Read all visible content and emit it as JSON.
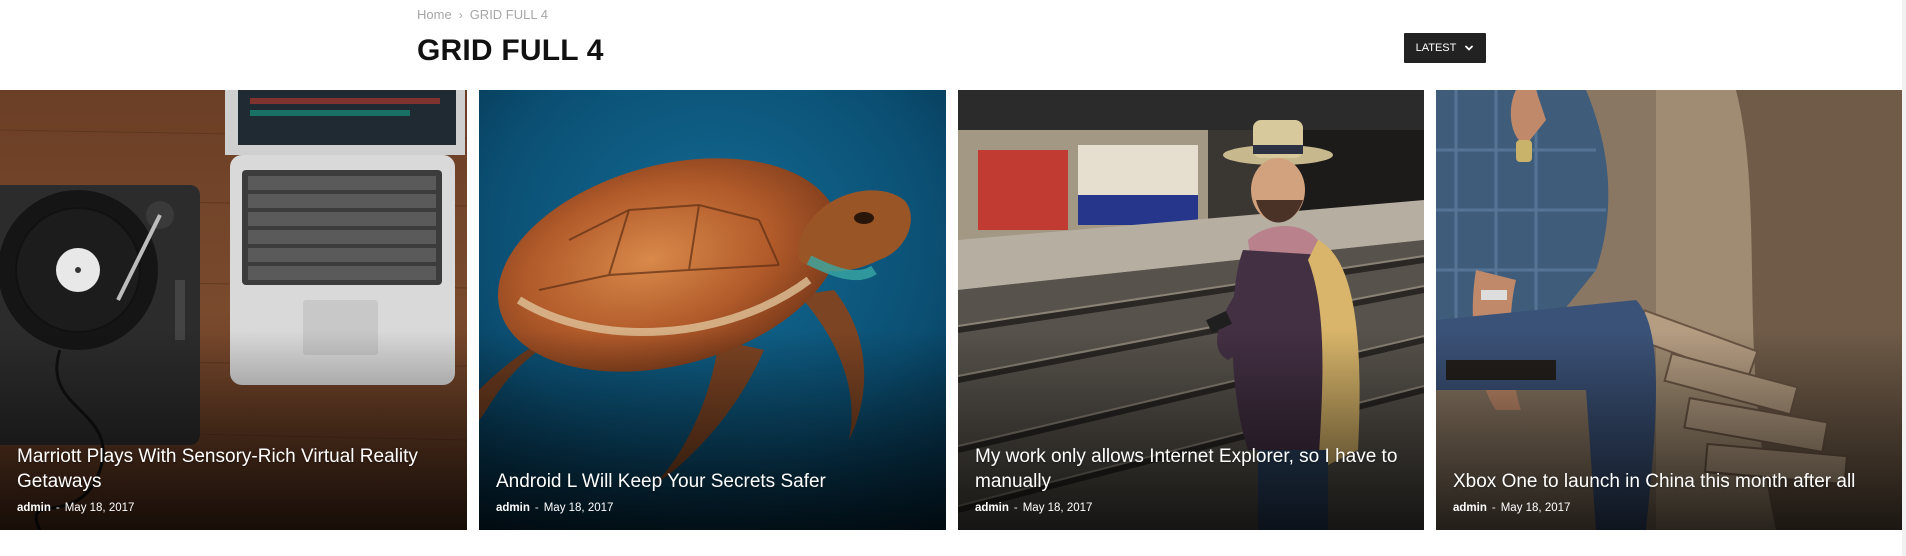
{
  "breadcrumb": {
    "home": "Home",
    "separator": "›",
    "current": "GRID FULL 4"
  },
  "page": {
    "title": "GRID FULL 4"
  },
  "sort": {
    "label": "LATEST",
    "icon": "chevron-down-icon"
  },
  "posts": [
    {
      "title": "Marriott Plays With Sensory-Rich Virtual Reality Getaways",
      "author": "admin",
      "separator": "-",
      "date": "May 18, 2017"
    },
    {
      "title": "Android L Will Keep Your Secrets Safer",
      "author": "admin",
      "separator": "-",
      "date": "May 18, 2017"
    },
    {
      "title": "My work only allows Internet Explorer, so I have to manually",
      "author": "admin",
      "separator": "-",
      "date": "May 18, 2017"
    },
    {
      "title": "Xbox One to launch in China this month after all",
      "author": "admin",
      "separator": "-",
      "date": "May 18, 2017"
    }
  ],
  "colors": {
    "dropdown_bg": "#222222",
    "breadcrumb": "#a6a6a6",
    "title": "#111111"
  }
}
